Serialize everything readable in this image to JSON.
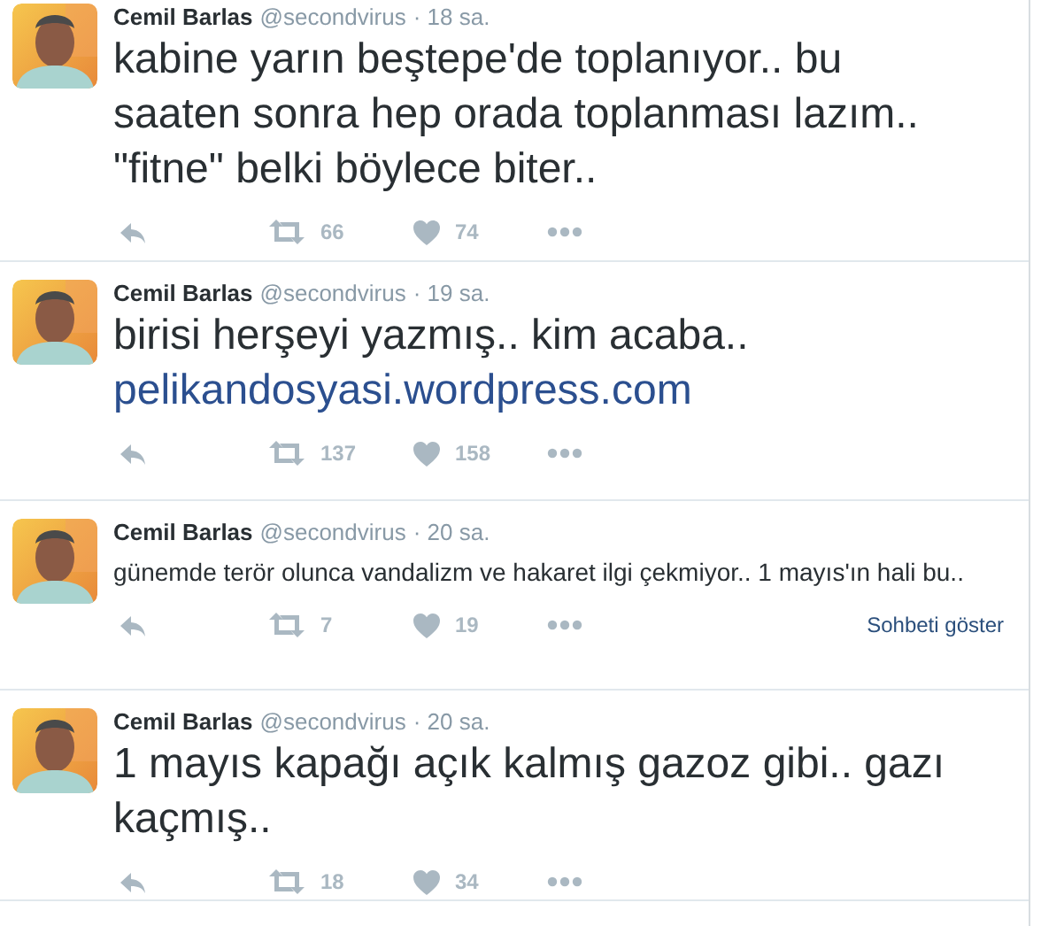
{
  "tweets": [
    {
      "author": "Cemil Barlas",
      "handle": "@secondvirus",
      "time": "· 18 sa.",
      "kind": "large",
      "text": "kabine yarın beştepe'de toplanıyor.. bu saaten sonra hep orada toplanması lazım.. \"fitne\" belki böylece biter..",
      "retweets": "66",
      "likes": "74"
    },
    {
      "author": "Cemil Barlas",
      "handle": "@secondvirus",
      "time": "· 19 sa.",
      "kind": "large",
      "text": "birisi herşeyi yazmış.. kim acaba..",
      "link": "pelikandosyasi.wordpress.com",
      "retweets": "137",
      "likes": "158"
    },
    {
      "author": "Cemil Barlas",
      "handle": "@secondvirus",
      "time": "· 20 sa.",
      "kind": "normal",
      "text": "günemde terör olunca vandalizm ve hakaret ilgi çekmiyor.. 1 mayıs'ın hali bu..",
      "retweets": "7",
      "likes": "19",
      "conversation": "Sohbeti göster"
    },
    {
      "author": "Cemil Barlas",
      "handle": "@secondvirus",
      "time": "· 20 sa.",
      "kind": "large",
      "text": "1 mayıs kapağı açık kalmış gazoz gibi.. gazı kaçmış..",
      "retweets": "18",
      "likes": "34"
    }
  ]
}
